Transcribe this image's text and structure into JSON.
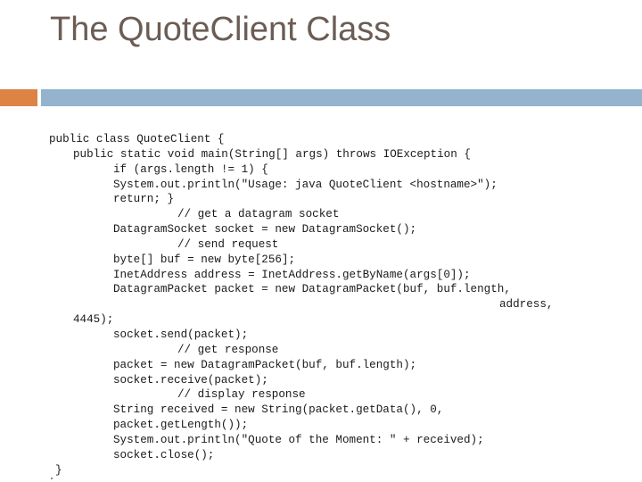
{
  "slide": {
    "title": "The QuoteClient Class",
    "colors": {
      "title": "#6b5d55",
      "accent_orange": "#de8346",
      "accent_blue": "#93b3ce"
    }
  },
  "code": {
    "language": "java",
    "lines": [
      {
        "indent": 0,
        "text": "public class QuoteClient {"
      },
      {
        "indent": 1,
        "text": "public static void main(String[] args) throws IOException {"
      },
      {
        "indent": 2,
        "text": "if (args.length != 1) {"
      },
      {
        "indent": 2,
        "text": "System.out.println(\"Usage: java QuoteClient <hostname>\");"
      },
      {
        "indent": 2,
        "text": "return; }"
      },
      {
        "indent": 3,
        "text": "// get a datagram socket"
      },
      {
        "indent": 2,
        "text": "DatagramSocket socket = new DatagramSocket();"
      },
      {
        "indent": 3,
        "text": "// send request"
      },
      {
        "indent": 2,
        "text": "byte[] buf = new byte[256];"
      },
      {
        "indent": 2,
        "text": "InetAddress address = InetAddress.getByName(args[0]);"
      },
      {
        "indent": 2,
        "text": "DatagramPacket packet = new DatagramPacket(buf, buf.length,"
      },
      {
        "indent": 4,
        "text": "address,"
      },
      {
        "indent": 1,
        "text": "4445);"
      },
      {
        "indent": 2,
        "text": "socket.send(packet);"
      },
      {
        "indent": 3,
        "text": "// get response"
      },
      {
        "indent": 2,
        "text": "packet = new DatagramPacket(buf, buf.length);"
      },
      {
        "indent": 2,
        "text": "socket.receive(packet);"
      },
      {
        "indent": 3,
        "text": "// display response"
      },
      {
        "indent": 2,
        "text": "String received = new String(packet.getData(), 0,"
      },
      {
        "indent": 2,
        "text": "packet.getLength());"
      },
      {
        "indent": 2,
        "text": "System.out.println(\"Quote of the Moment: \" + received);"
      },
      {
        "indent": 2,
        "text": "socket.close();"
      },
      {
        "indent": "b",
        "text": "}"
      }
    ]
  }
}
